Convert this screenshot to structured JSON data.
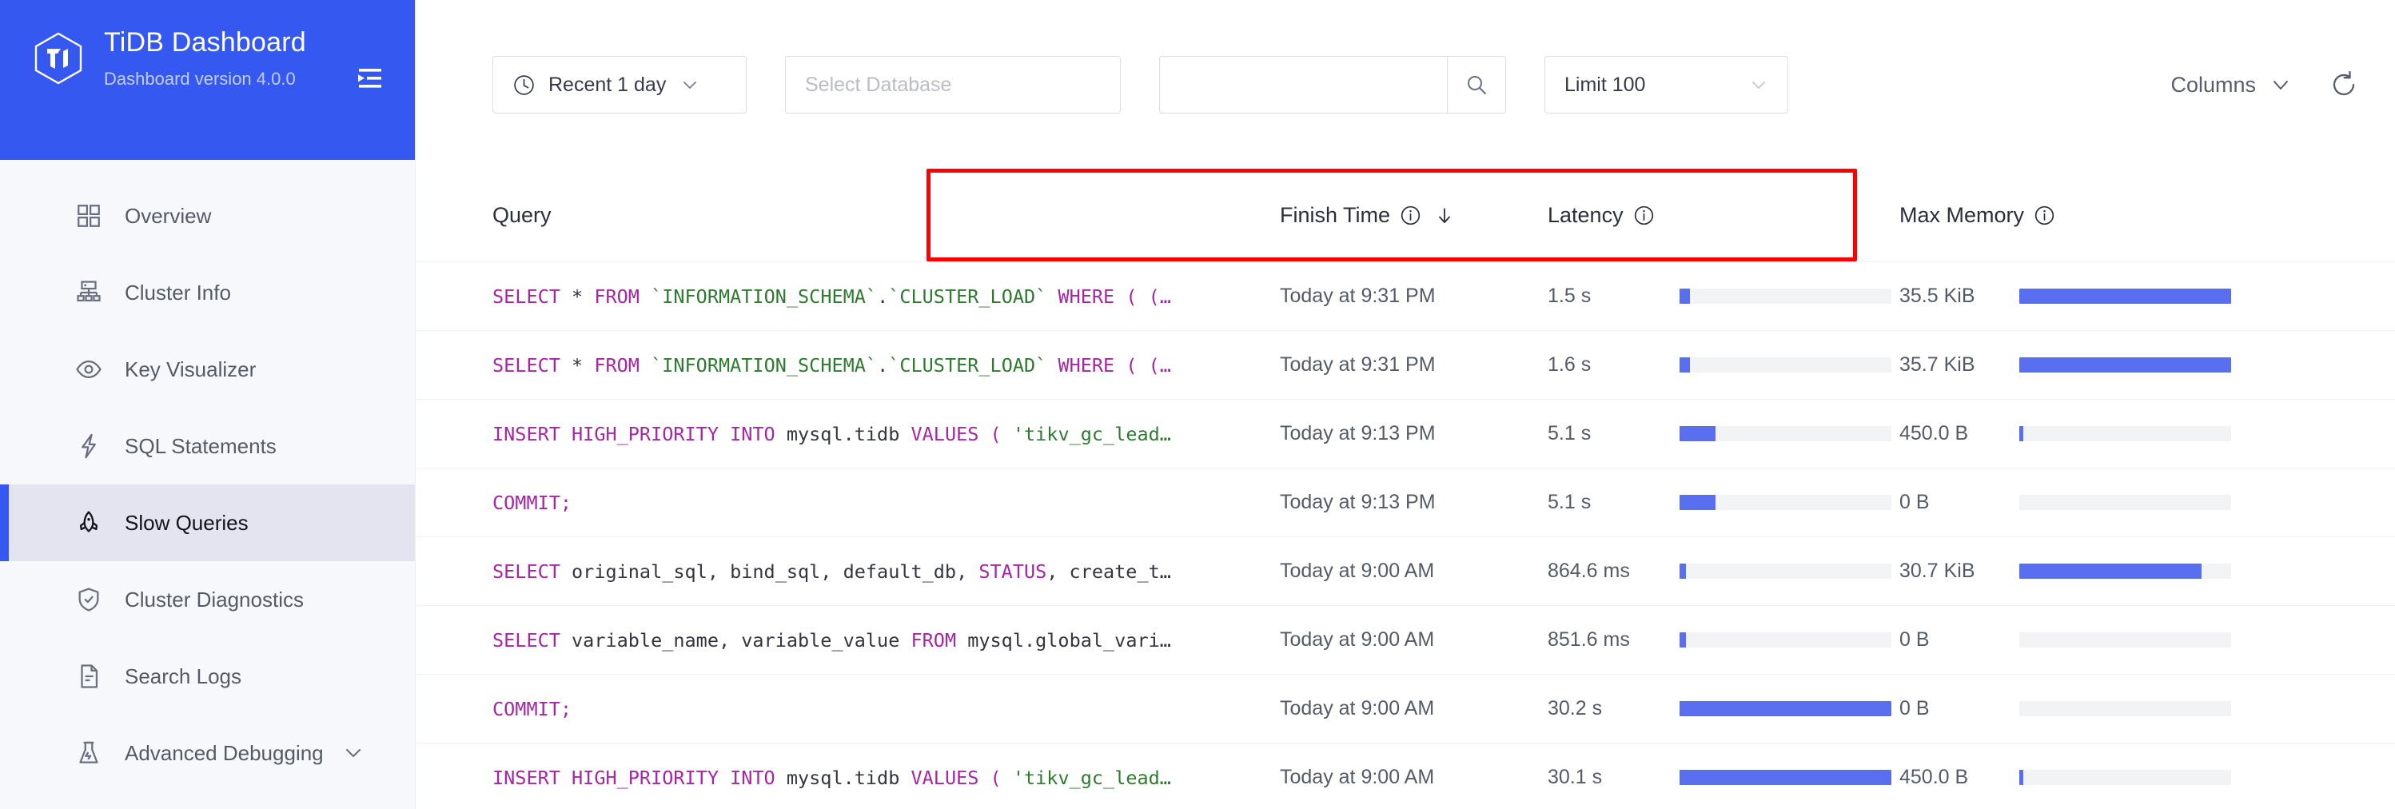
{
  "brand": {
    "title": "TiDB Dashboard",
    "subtitle": "Dashboard version 4.0.0",
    "collapse_icon": "menu-fold-icon",
    "accent_color": "#3558f0"
  },
  "sidebar": {
    "items": [
      {
        "label": "Overview",
        "icon": "grid-icon",
        "active": false
      },
      {
        "label": "Cluster Info",
        "icon": "cluster-icon",
        "active": false
      },
      {
        "label": "Key Visualizer",
        "icon": "eye-icon",
        "active": false
      },
      {
        "label": "SQL Statements",
        "icon": "lightning-icon",
        "active": false
      },
      {
        "label": "Slow Queries",
        "icon": "rocket-icon",
        "active": true
      },
      {
        "label": "Cluster Diagnostics",
        "icon": "shield-check-icon",
        "active": false
      },
      {
        "label": "Search Logs",
        "icon": "document-icon",
        "active": false
      },
      {
        "label": "Advanced Debugging",
        "icon": "flask-icon",
        "active": false,
        "expandable": true
      }
    ]
  },
  "toolbar": {
    "time_range": {
      "label": "Recent 1 day",
      "icon": "clock-icon",
      "chevron": "chevron-down-icon"
    },
    "database": {
      "placeholder": "Select Database",
      "value": ""
    },
    "search": {
      "value": "",
      "placeholder": "",
      "icon": "search-icon"
    },
    "limit": {
      "label": "Limit 100",
      "chevron": "chevron-down-icon"
    },
    "columns": {
      "label": "Columns",
      "chevron": "chevron-down-icon"
    },
    "refresh": {
      "icon": "refresh-icon"
    }
  },
  "table": {
    "columns": [
      {
        "key": "query",
        "label": "Query",
        "info": false,
        "sort": ""
      },
      {
        "key": "finish",
        "label": "Finish Time",
        "info": true,
        "sort": "desc"
      },
      {
        "key": "latency",
        "label": "Latency",
        "info": true,
        "sort": ""
      },
      {
        "key": "memory",
        "label": "Max Memory",
        "info": true,
        "sort": ""
      }
    ],
    "rows": [
      {
        "query_tokens": [
          {
            "t": "SELECT",
            "c": "kw"
          },
          {
            "t": " * ",
            "c": "pl"
          },
          {
            "t": "FROM",
            "c": "kw"
          },
          {
            "t": " ",
            "c": "pl"
          },
          {
            "t": "`INFORMATION_SCHEMA`",
            "c": "id"
          },
          {
            "t": ".",
            "c": "pl"
          },
          {
            "t": "`CLUSTER_LOAD`",
            "c": "id"
          },
          {
            "t": " ",
            "c": "pl"
          },
          {
            "t": "WHERE",
            "c": "kw"
          },
          {
            "t": " ",
            "c": "pl"
          },
          {
            "t": "(",
            "c": "punct"
          },
          {
            "t": " ",
            "c": "pl"
          },
          {
            "t": "(…",
            "c": "punct"
          }
        ],
        "finish_time": "Today at 9:31 PM",
        "latency": "1.5 s",
        "latency_pct": 5,
        "memory": "35.5 KiB",
        "memory_pct": 100
      },
      {
        "query_tokens": [
          {
            "t": "SELECT",
            "c": "kw"
          },
          {
            "t": " * ",
            "c": "pl"
          },
          {
            "t": "FROM",
            "c": "kw"
          },
          {
            "t": " ",
            "c": "pl"
          },
          {
            "t": "`INFORMATION_SCHEMA`",
            "c": "id"
          },
          {
            "t": ".",
            "c": "pl"
          },
          {
            "t": "`CLUSTER_LOAD`",
            "c": "id"
          },
          {
            "t": " ",
            "c": "pl"
          },
          {
            "t": "WHERE",
            "c": "kw"
          },
          {
            "t": " ",
            "c": "pl"
          },
          {
            "t": "(",
            "c": "punct"
          },
          {
            "t": " ",
            "c": "pl"
          },
          {
            "t": "(…",
            "c": "punct"
          }
        ],
        "finish_time": "Today at 9:31 PM",
        "latency": "1.6 s",
        "latency_pct": 5,
        "memory": "35.7 KiB",
        "memory_pct": 100
      },
      {
        "query_tokens": [
          {
            "t": "INSERT HIGH_PRIORITY INTO",
            "c": "kw"
          },
          {
            "t": " mysql.tidb ",
            "c": "pl"
          },
          {
            "t": "VALUES",
            "c": "kw"
          },
          {
            "t": " ",
            "c": "pl"
          },
          {
            "t": "(",
            "c": "punct"
          },
          {
            "t": " ",
            "c": "pl"
          },
          {
            "t": "'tikv_gc_lead…",
            "c": "str"
          }
        ],
        "finish_time": "Today at 9:13 PM",
        "latency": "5.1 s",
        "latency_pct": 17,
        "memory": "450.0 B",
        "memory_pct": 2
      },
      {
        "query_tokens": [
          {
            "t": "COMMIT",
            "c": "kw"
          },
          {
            "t": ";",
            "c": "punct"
          }
        ],
        "finish_time": "Today at 9:13 PM",
        "latency": "5.1 s",
        "latency_pct": 17,
        "memory": "0 B",
        "memory_pct": 0
      },
      {
        "query_tokens": [
          {
            "t": "SELECT",
            "c": "kw"
          },
          {
            "t": " original_sql, bind_sql, default_db, ",
            "c": "pl"
          },
          {
            "t": "STATUS",
            "c": "kw"
          },
          {
            "t": ", create_t…",
            "c": "pl"
          }
        ],
        "finish_time": "Today at 9:00 AM",
        "latency": "864.6 ms",
        "latency_pct": 3,
        "memory": "30.7 KiB",
        "memory_pct": 86
      },
      {
        "query_tokens": [
          {
            "t": "SELECT",
            "c": "kw"
          },
          {
            "t": " variable_name, variable_value ",
            "c": "pl"
          },
          {
            "t": "FROM",
            "c": "kw"
          },
          {
            "t": " mysql.global_vari…",
            "c": "pl"
          }
        ],
        "finish_time": "Today at 9:00 AM",
        "latency": "851.6 ms",
        "latency_pct": 3,
        "memory": "0 B",
        "memory_pct": 0
      },
      {
        "query_tokens": [
          {
            "t": "COMMIT",
            "c": "kw"
          },
          {
            "t": ";",
            "c": "punct"
          }
        ],
        "finish_time": "Today at 9:00 AM",
        "latency": "30.2 s",
        "latency_pct": 100,
        "memory": "0 B",
        "memory_pct": 0
      },
      {
        "query_tokens": [
          {
            "t": "INSERT HIGH_PRIORITY INTO",
            "c": "kw"
          },
          {
            "t": " mysql.tidb ",
            "c": "pl"
          },
          {
            "t": "VALUES",
            "c": "kw"
          },
          {
            "t": " ",
            "c": "pl"
          },
          {
            "t": "(",
            "c": "punct"
          },
          {
            "t": " ",
            "c": "pl"
          },
          {
            "t": "'tikv_gc_lead…",
            "c": "str"
          }
        ],
        "finish_time": "Today at 9:00 AM",
        "latency": "30.1 s",
        "latency_pct": 100,
        "memory": "450.0 B",
        "memory_pct": 2
      }
    ]
  },
  "annotation": {
    "color": "#ff0000",
    "covers": [
      "Finish Time",
      "Latency",
      "Max Memory"
    ]
  }
}
